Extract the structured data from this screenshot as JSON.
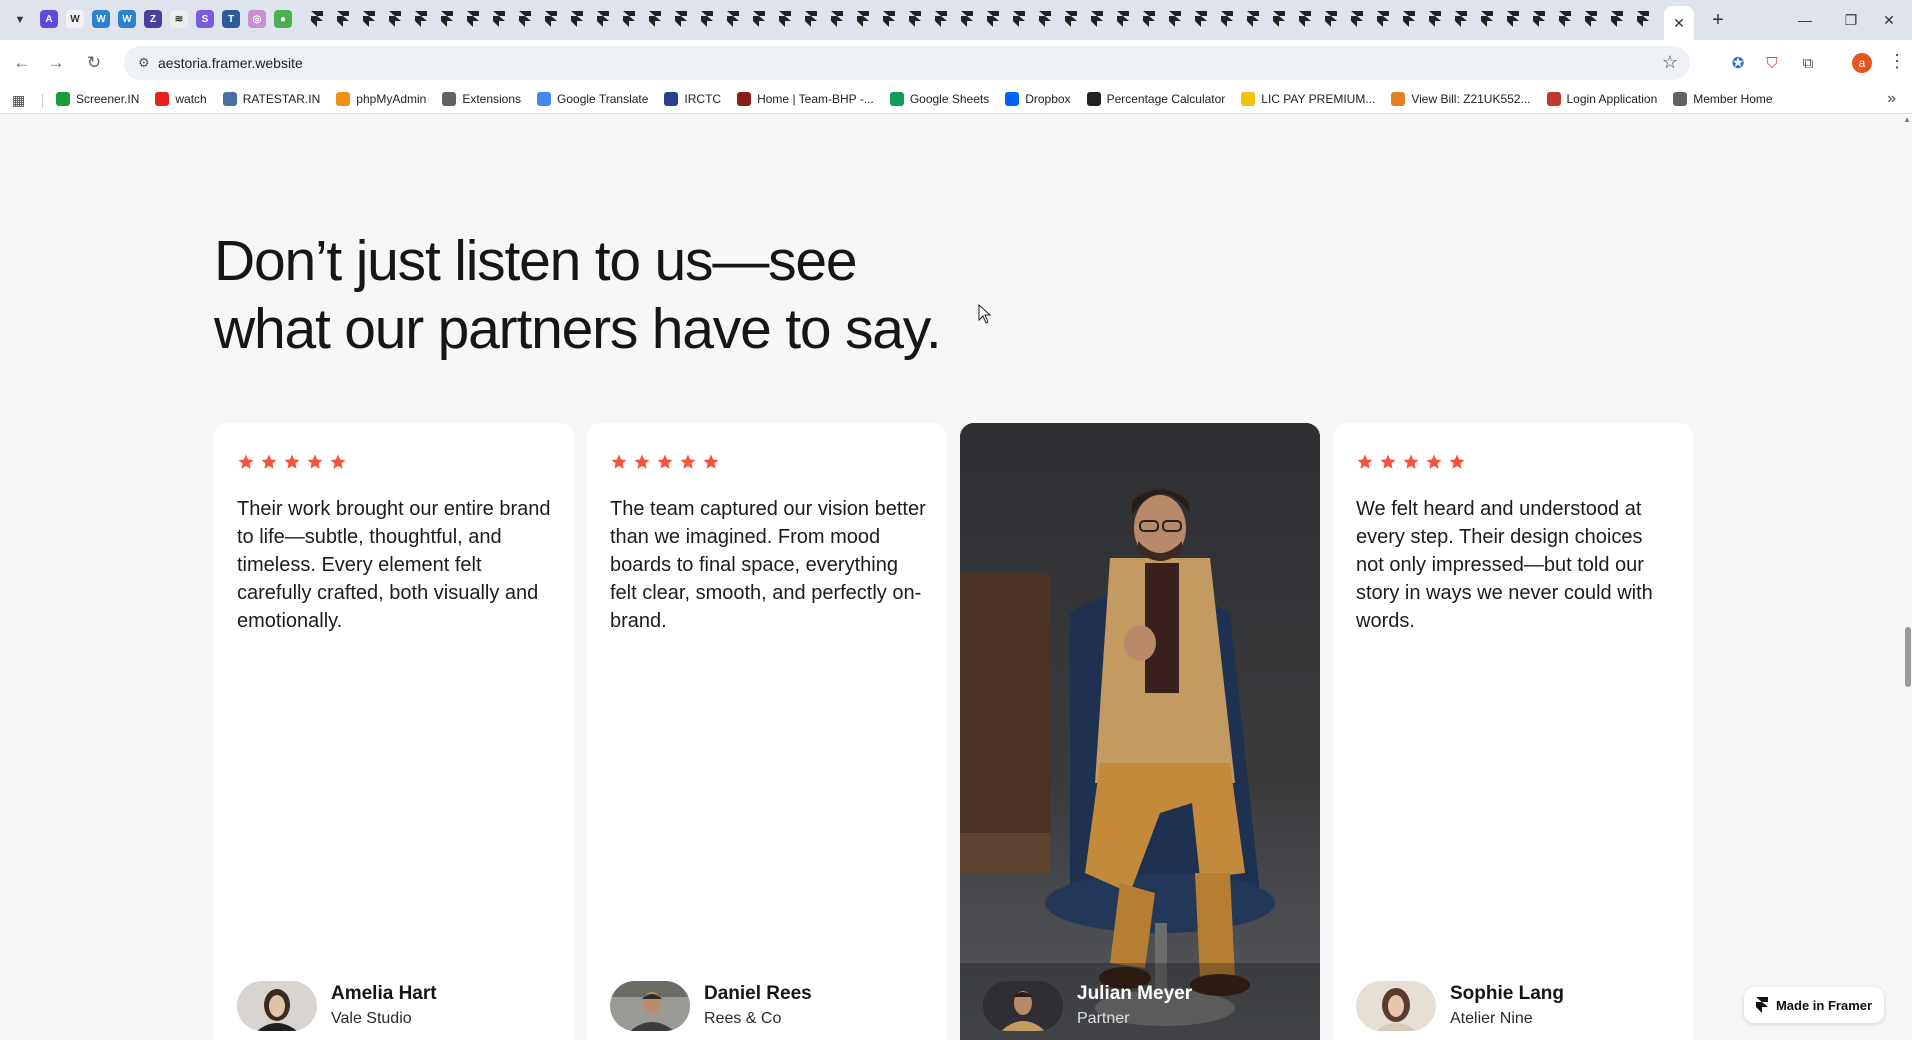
{
  "browser": {
    "url": "aestoria.framer.website",
    "bookmarks": [
      {
        "label": "Screener.IN",
        "icon": "bar-chart-icon",
        "color": "#1a9e3a"
      },
      {
        "label": "watch",
        "icon": "youtube-icon",
        "color": "#e62117"
      },
      {
        "label": "RATESTAR.IN",
        "icon": "ratestar-icon",
        "color": "#4a6fa5"
      },
      {
        "label": "phpMyAdmin",
        "icon": "phpmyadmin-icon",
        "color": "#f29111"
      },
      {
        "label": "Extensions",
        "icon": "puzzle-icon",
        "color": "#5f6368"
      },
      {
        "label": "Google Translate",
        "icon": "translate-icon",
        "color": "#4285f4"
      },
      {
        "label": "IRCTC",
        "icon": "irctc-icon",
        "color": "#2c3e91"
      },
      {
        "label": "Home | Team-BHP -...",
        "icon": "teambhp-icon",
        "color": "#8b1a1a"
      },
      {
        "label": "Google Sheets",
        "icon": "sheets-icon",
        "color": "#0f9d58"
      },
      {
        "label": "Dropbox",
        "icon": "dropbox-icon",
        "color": "#0061fe"
      },
      {
        "label": "Percentage Calculator",
        "icon": "percent-icon",
        "color": "#222222"
      },
      {
        "label": "LIC PAY PREMIUM...",
        "icon": "lic-icon",
        "color": "#f4c20d"
      },
      {
        "label": "View Bill: Z21UK552...",
        "icon": "bill-icon",
        "color": "#e67e22"
      },
      {
        "label": "Login Application",
        "icon": "login-icon",
        "color": "#c0392b"
      },
      {
        "label": "Member Home",
        "icon": "globe-icon",
        "color": "#5f6368"
      }
    ],
    "profile_initial": "a"
  },
  "section": {
    "headline_line1": "Don’t just listen to us—see",
    "headline_line2": "what our partners have to say."
  },
  "testimonials": [
    {
      "rating": 5,
      "quote": "Their work brought our entire brand to life—subtle, thoughtful, and timeless. Every element felt carefully crafted, both visually and emotionally.",
      "name": "Amelia Hart",
      "company": "Vale Studio"
    },
    {
      "rating": 5,
      "quote": "The team captured our vision better than we imagined. From mood boards to final space, everything felt clear, smooth, and perfectly on-brand.",
      "name": "Daniel Rees",
      "company": "Rees & Co"
    },
    {
      "rating": null,
      "quote": "",
      "name": "Julian Meyer",
      "company": "Partner"
    },
    {
      "rating": 5,
      "quote": "We felt heard and understood at every step. Their design choices not only impressed—but told our story in ways we never could with words.",
      "name": "Sophie Lang",
      "company": "Atelier Nine"
    }
  ],
  "badge": {
    "label": "Made in Framer"
  },
  "colors": {
    "star": "#f4553a",
    "page_bg": "#f7f7f7",
    "card_bg": "#ffffff",
    "text": "#161616"
  }
}
